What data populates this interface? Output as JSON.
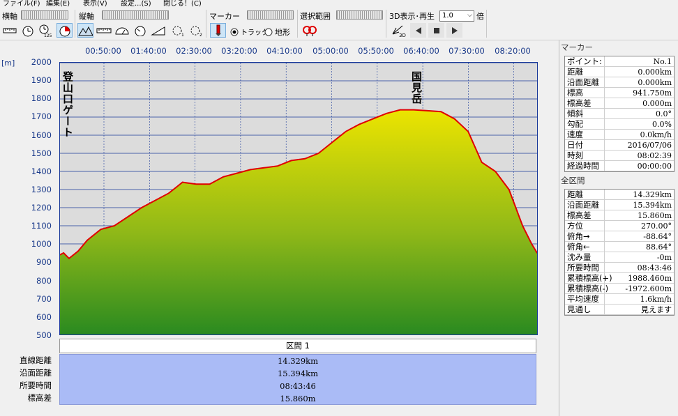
{
  "menu": [
    "ファイル(F)",
    "編集(E)",
    "表示(V)",
    "設定...(S)",
    "閉じる！(C)"
  ],
  "toolbar": {
    "horizontal_axis_label": "横軸",
    "vertical_axis_label": "縦軸",
    "marker_label": "マーカー",
    "selection_label": "選択範囲",
    "play3d_label": "3D表示･再生",
    "speed_value": "1.0",
    "speed_unit": "倍",
    "radio_track": "トラック",
    "radio_terrain": "地形",
    "selected_radio": "track",
    "icon_badge_125": "125",
    "icon_badge_3d": "3D",
    "icon_badge_1": "1",
    "icon_badge_2": "2"
  },
  "chart": {
    "unit": "[m]",
    "time_ticks": [
      "00:50:00",
      "01:40:00",
      "02:30:00",
      "03:20:00",
      "04:10:00",
      "05:00:00",
      "05:50:00",
      "06:40:00",
      "07:30:00",
      "08:20:00"
    ],
    "elev_ticks": [
      "2000",
      "1900",
      "1800",
      "1700",
      "1600",
      "1500",
      "1400",
      "1300",
      "1200",
      "1100",
      "1000",
      "900",
      "800",
      "700",
      "600",
      "500"
    ],
    "annotation_start": "登山口ゲート",
    "annotation_peak": "国見岳",
    "colors": {
      "track": "#e00000",
      "fill_top": "#e8e000",
      "fill_bottom": "#2a8a20",
      "grid": "#1a3a9a"
    }
  },
  "chart_data": {
    "type": "area",
    "title": "",
    "xlabel": "",
    "ylabel": "[m]",
    "ylim": [
      500,
      2000
    ],
    "x_ticks": [
      "00:50:00",
      "01:40:00",
      "02:30:00",
      "03:20:00",
      "04:10:00",
      "05:00:00",
      "05:50:00",
      "06:40:00",
      "07:30:00",
      "08:20:00"
    ],
    "xlim_minutes": [
      0,
      526
    ],
    "grid": true,
    "series": [
      {
        "points": [
          [
            0,
            940
          ],
          [
            4,
            950
          ],
          [
            10,
            920
          ],
          [
            20,
            960
          ],
          [
            30,
            1020
          ],
          [
            45,
            1080
          ],
          [
            60,
            1100
          ],
          [
            75,
            1150
          ],
          [
            90,
            1200
          ],
          [
            105,
            1240
          ],
          [
            120,
            1280
          ],
          [
            135,
            1340
          ],
          [
            150,
            1330
          ],
          [
            165,
            1330
          ],
          [
            180,
            1370
          ],
          [
            195,
            1390
          ],
          [
            210,
            1410
          ],
          [
            225,
            1420
          ],
          [
            240,
            1430
          ],
          [
            255,
            1460
          ],
          [
            270,
            1470
          ],
          [
            285,
            1500
          ],
          [
            300,
            1560
          ],
          [
            315,
            1620
          ],
          [
            330,
            1660
          ],
          [
            345,
            1690
          ],
          [
            360,
            1720
          ],
          [
            375,
            1740
          ],
          [
            390,
            1740
          ],
          [
            405,
            1735
          ],
          [
            420,
            1730
          ],
          [
            435,
            1690
          ],
          [
            450,
            1620
          ],
          [
            465,
            1450
          ],
          [
            480,
            1400
          ],
          [
            495,
            1300
          ],
          [
            510,
            1100
          ],
          [
            520,
            1000
          ],
          [
            526,
            950
          ]
        ]
      }
    ]
  },
  "section": {
    "header": "区間 1",
    "labels": [
      "直線距離",
      "沿面距離",
      "所要時間",
      "標高差"
    ],
    "values": [
      "14.329km",
      "15.394km",
      "08:43:46",
      "15.860m"
    ]
  },
  "marker_panel": {
    "title": "マーカー",
    "rows": [
      {
        "k": "ポイント:",
        "v": "No.1"
      },
      {
        "k": "距離",
        "v": "0.000km"
      },
      {
        "k": "沿面距離",
        "v": "0.000km"
      },
      {
        "k": "標高",
        "v": "941.750m"
      },
      {
        "k": "標高差",
        "v": "0.000m"
      },
      {
        "k": "傾斜",
        "v": "0.0°"
      },
      {
        "k": "勾配",
        "v": "0.0%"
      },
      {
        "k": "速度",
        "v": "0.0km/h"
      },
      {
        "k": "日付",
        "v": "2016/07/06"
      },
      {
        "k": "時刻",
        "v": "08:02:39"
      },
      {
        "k": "経過時間",
        "v": "00:00:00"
      }
    ]
  },
  "all_panel": {
    "title": "全区間",
    "rows": [
      {
        "k": "距離",
        "v": "14.329km"
      },
      {
        "k": "沿面距離",
        "v": "15.394km"
      },
      {
        "k": "標高差",
        "v": "15.860m"
      },
      {
        "k": "方位",
        "v": "270.00°"
      },
      {
        "k": "俯角→",
        "v": "-88.64°"
      },
      {
        "k": "俯角←",
        "v": "88.64°"
      },
      {
        "k": "沈み量",
        "v": "-0m"
      },
      {
        "k": "所要時間",
        "v": "08:43:46"
      },
      {
        "k": "累積標高(+)",
        "v": "1988.460m"
      },
      {
        "k": "累積標高(-)",
        "v": "-1972.600m"
      },
      {
        "k": "平均速度",
        "v": "1.6km/h"
      },
      {
        "k": "見通し",
        "v": "見えます"
      }
    ]
  }
}
